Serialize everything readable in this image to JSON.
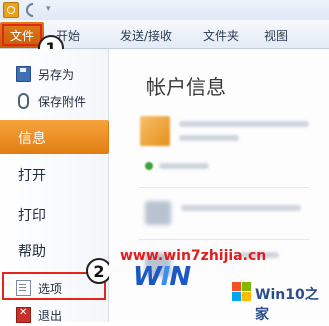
{
  "ribbon": {
    "tabs": [
      "开始",
      "发送/接收",
      "文件夹",
      "视图"
    ],
    "file_tab": "文件"
  },
  "nav": {
    "save_as": "另存为",
    "save_attachments": "保存附件",
    "info": "信息",
    "open": "打开",
    "print": "打印",
    "help": "帮助",
    "options": "选项",
    "exit": "退出"
  },
  "content": {
    "title": "帐户信息"
  },
  "callouts": {
    "step1": "1",
    "step2": "2"
  },
  "watermark": {
    "url": "www.win7zhijia.cn",
    "site": "Win10之家"
  },
  "colors": {
    "file_tab": "#c65d07",
    "selected_nav": "#e17d12",
    "callout_red": "#e3261b"
  },
  "icons": [
    "save-as-icon",
    "attachment-icon",
    "options-icon",
    "exit-icon"
  ]
}
